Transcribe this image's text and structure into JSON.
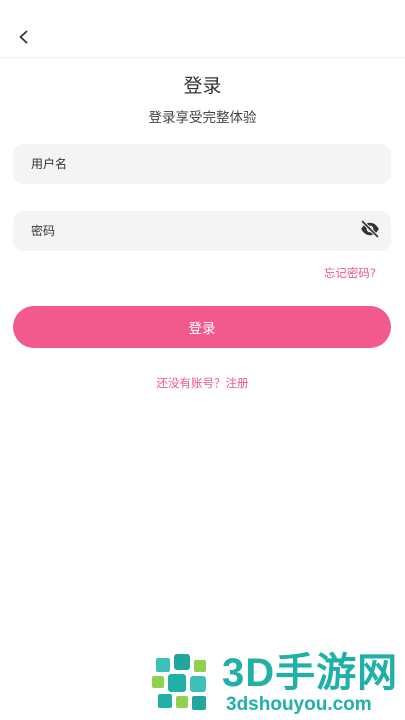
{
  "header": {
    "back_icon": "chevron-left-icon"
  },
  "title": "登录",
  "subtitle": "登录享受完整体验",
  "form": {
    "username_placeholder": "用户名",
    "username_value": "",
    "password_placeholder": "密码",
    "password_value": "",
    "password_toggle_icon": "eye-off-icon",
    "forgot_label": "忘记密码?",
    "login_label": "登录",
    "register_label": "还没有账号？注册"
  },
  "watermark": {
    "text": "3D手游网",
    "sub": "3dshouyou.com"
  },
  "colors": {
    "accent": "#f2598c",
    "link": "#f0588e",
    "field_bg": "#f4f4f4",
    "watermark": "#20b0a8"
  }
}
